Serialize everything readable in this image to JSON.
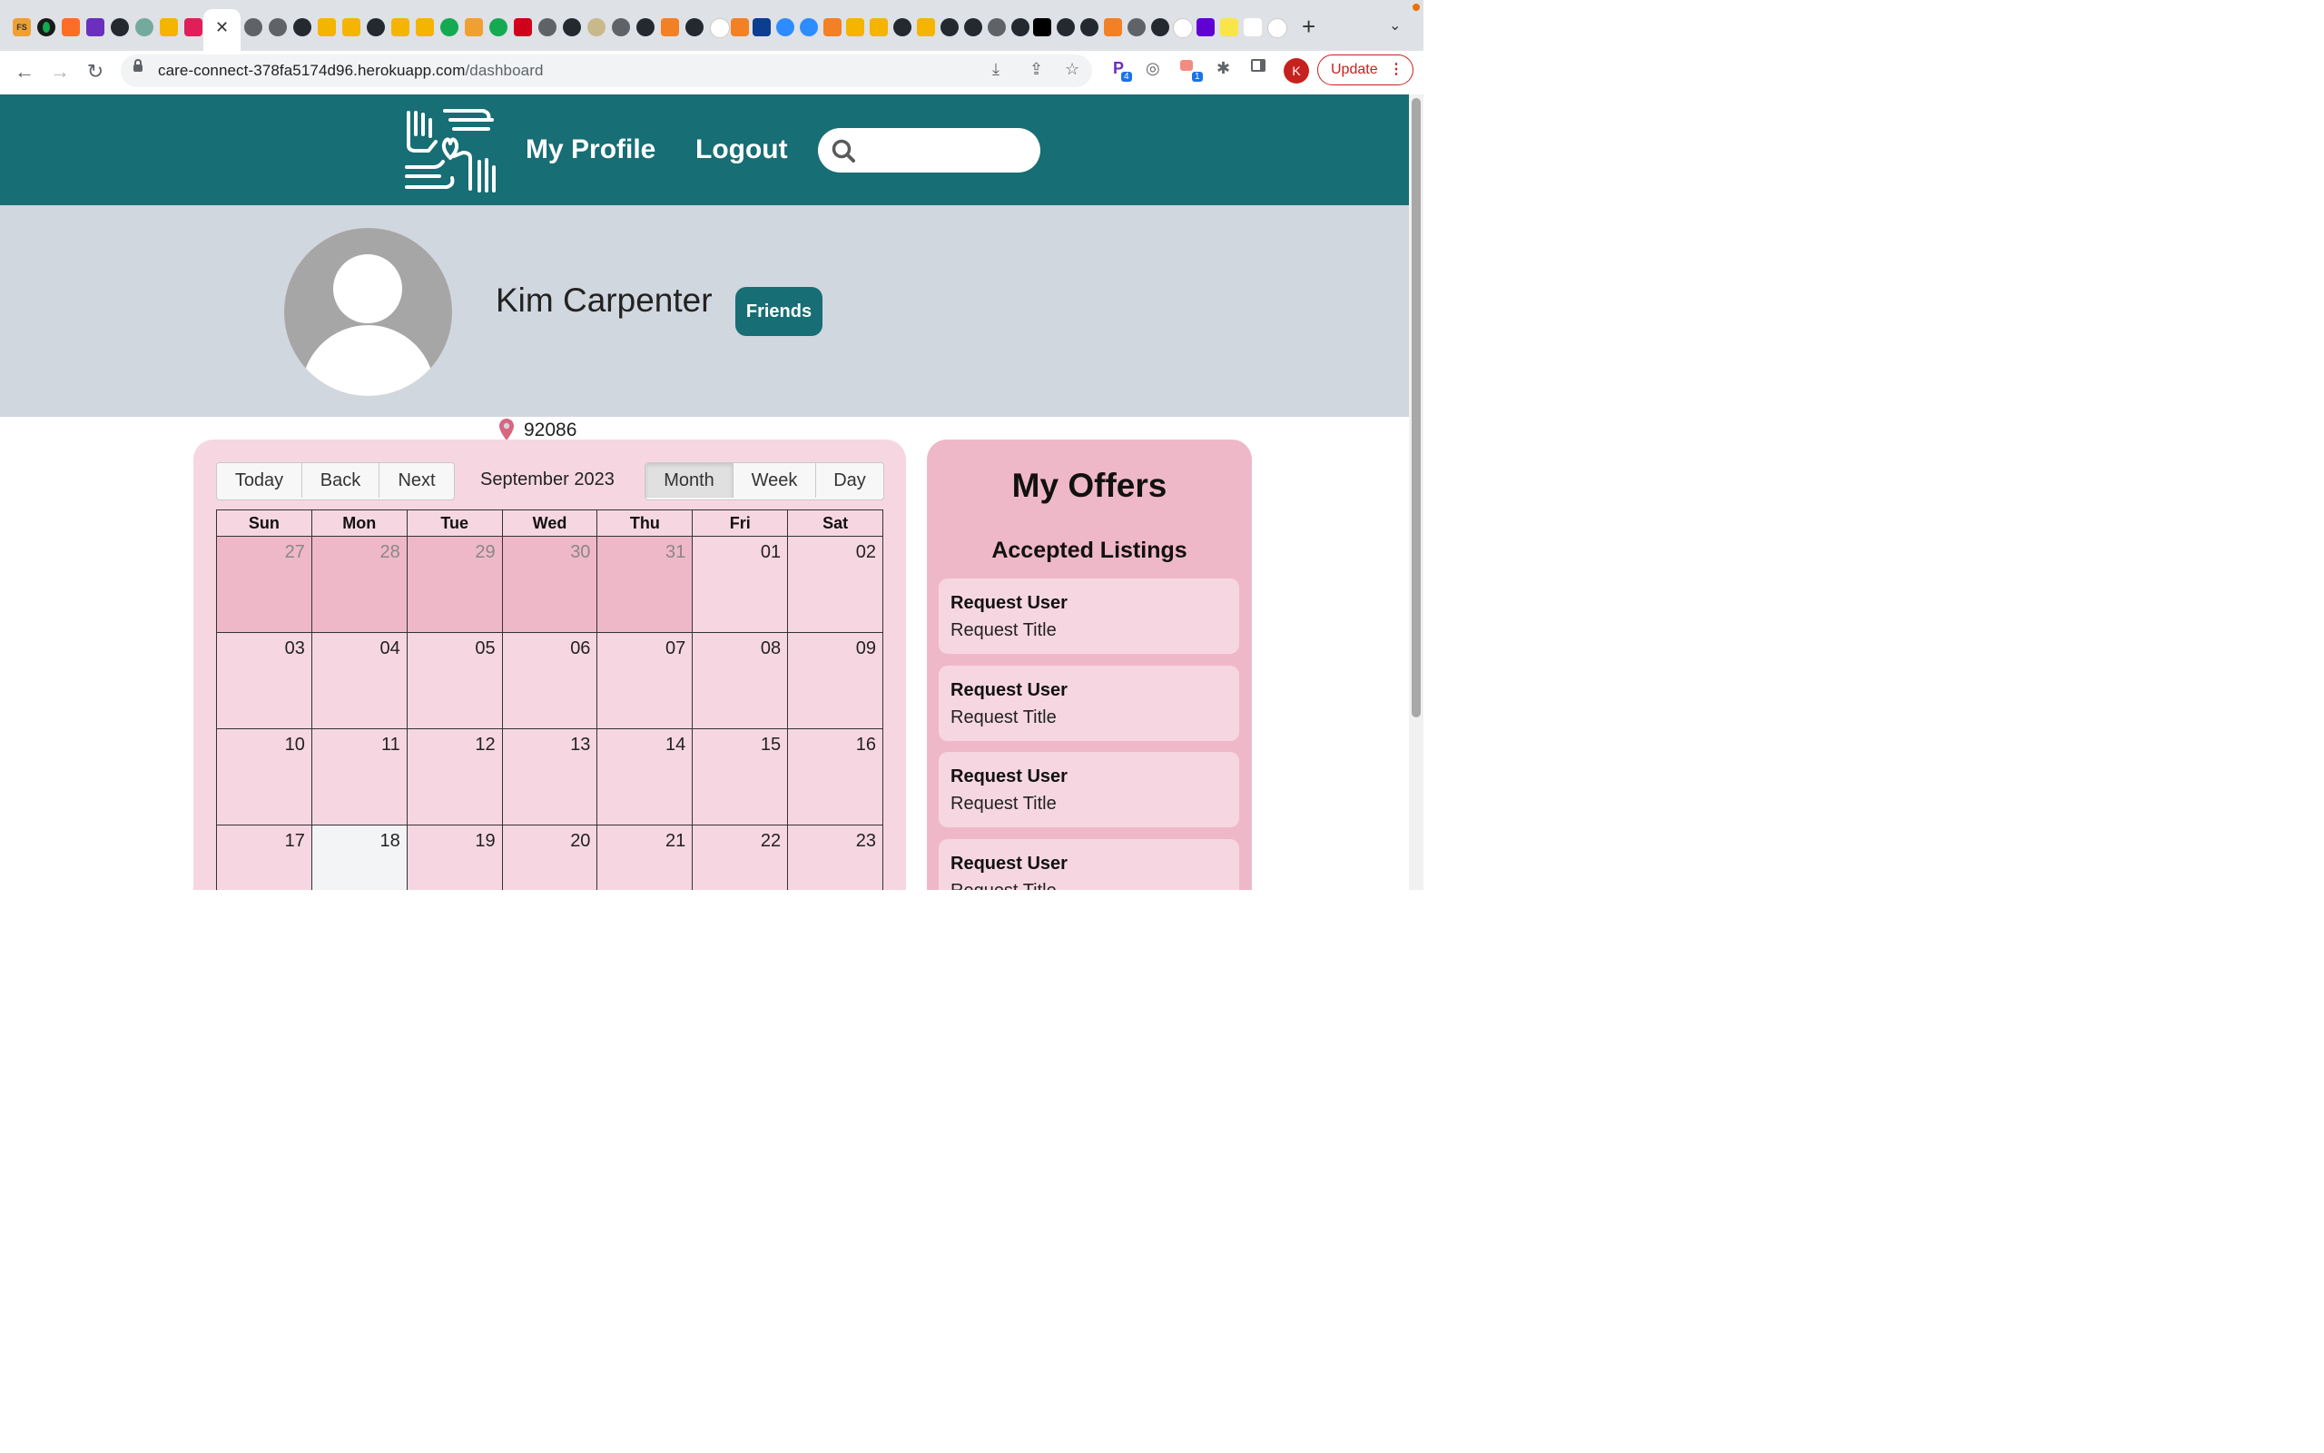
{
  "browser": {
    "active_tab_close": "✕",
    "new_tab": "+",
    "tab_menu": "⌄",
    "url_host": "care-connect-378fa5174d96.herokuapp.com",
    "url_path": "/dashboard",
    "update_label": "Update",
    "profile_initial": "K",
    "extension_badges": [
      "4",
      "1"
    ]
  },
  "header": {
    "nav": [
      "My Profile",
      "Logout"
    ],
    "search": {
      "placeholder": "",
      "value": ""
    }
  },
  "profile": {
    "name": "Kim Carpenter",
    "zip": "92086",
    "friends_label": "Friends"
  },
  "calendar": {
    "nav_buttons": [
      "Today",
      "Back",
      "Next"
    ],
    "label": "September 2023",
    "views": [
      "Month",
      "Week",
      "Day"
    ],
    "active_view": "Month",
    "weekdays": [
      "Sun",
      "Mon",
      "Tue",
      "Wed",
      "Thu",
      "Fri",
      "Sat"
    ],
    "weeks": [
      [
        "27",
        "28",
        "29",
        "30",
        "31",
        "01",
        "02"
      ],
      [
        "03",
        "04",
        "05",
        "06",
        "07",
        "08",
        "09"
      ],
      [
        "10",
        "11",
        "12",
        "13",
        "14",
        "15",
        "16"
      ],
      [
        "17",
        "18",
        "19",
        "20",
        "21",
        "22",
        "23"
      ]
    ],
    "out_of_month_days": [
      "27",
      "28",
      "29",
      "30",
      "31"
    ],
    "highlighted_day": "18"
  },
  "offers": {
    "title": "My Offers",
    "section": "Accepted Listings",
    "listings": [
      {
        "user": "Request User",
        "title": "Request Title"
      },
      {
        "user": "Request User",
        "title": "Request Title"
      },
      {
        "user": "Request User",
        "title": "Request Title"
      },
      {
        "user": "Request User",
        "title": "Request Title"
      }
    ]
  },
  "colors": {
    "header_teal": "#176e74",
    "profile_band": "#d0d7de",
    "calendar_bg": "#f6d7e1",
    "offers_bg": "#efb8c8",
    "pin": "#d9657f"
  }
}
